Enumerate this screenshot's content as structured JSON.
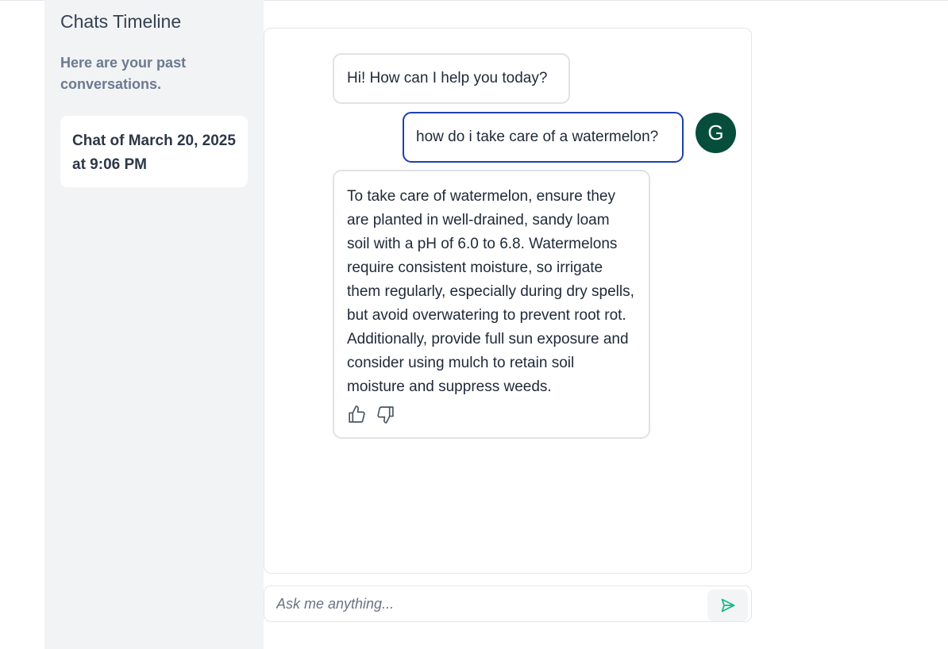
{
  "sidebar": {
    "title": "Chats Timeline",
    "subtitle": "Here are your past conversations.",
    "history": [
      {
        "label": "Chat of March 20, 2025 at 9:06 PM"
      }
    ]
  },
  "messages": [
    {
      "role": "assistant",
      "text": "Hi! How can I help you today?"
    },
    {
      "role": "user",
      "text": "how do i take care of a watermelon?",
      "avatar_initial": "G"
    },
    {
      "role": "assistant",
      "text": "To take care of watermelon, ensure they are planted in well-drained, sandy loam soil with a pH of 6.0 to 6.8. Watermelons require consistent moisture, so irrigate them regularly, especially during dry spells, but avoid overwatering to prevent root rot. Additionally, provide full sun exposure and consider using mulch to retain soil moisture and suppress weeds."
    }
  ],
  "feedback": {
    "like_icon": "thumbs-up-icon",
    "dislike_icon": "thumbs-down-icon"
  },
  "composer": {
    "placeholder": "Ask me anything...",
    "value": "",
    "send_icon": "send-icon"
  },
  "colors": {
    "sidebar_bg": "#f2f3f5",
    "user_bubble_border": "#1e40af",
    "avatar_bg": "#064e3b",
    "send_icon": "#10b981"
  }
}
